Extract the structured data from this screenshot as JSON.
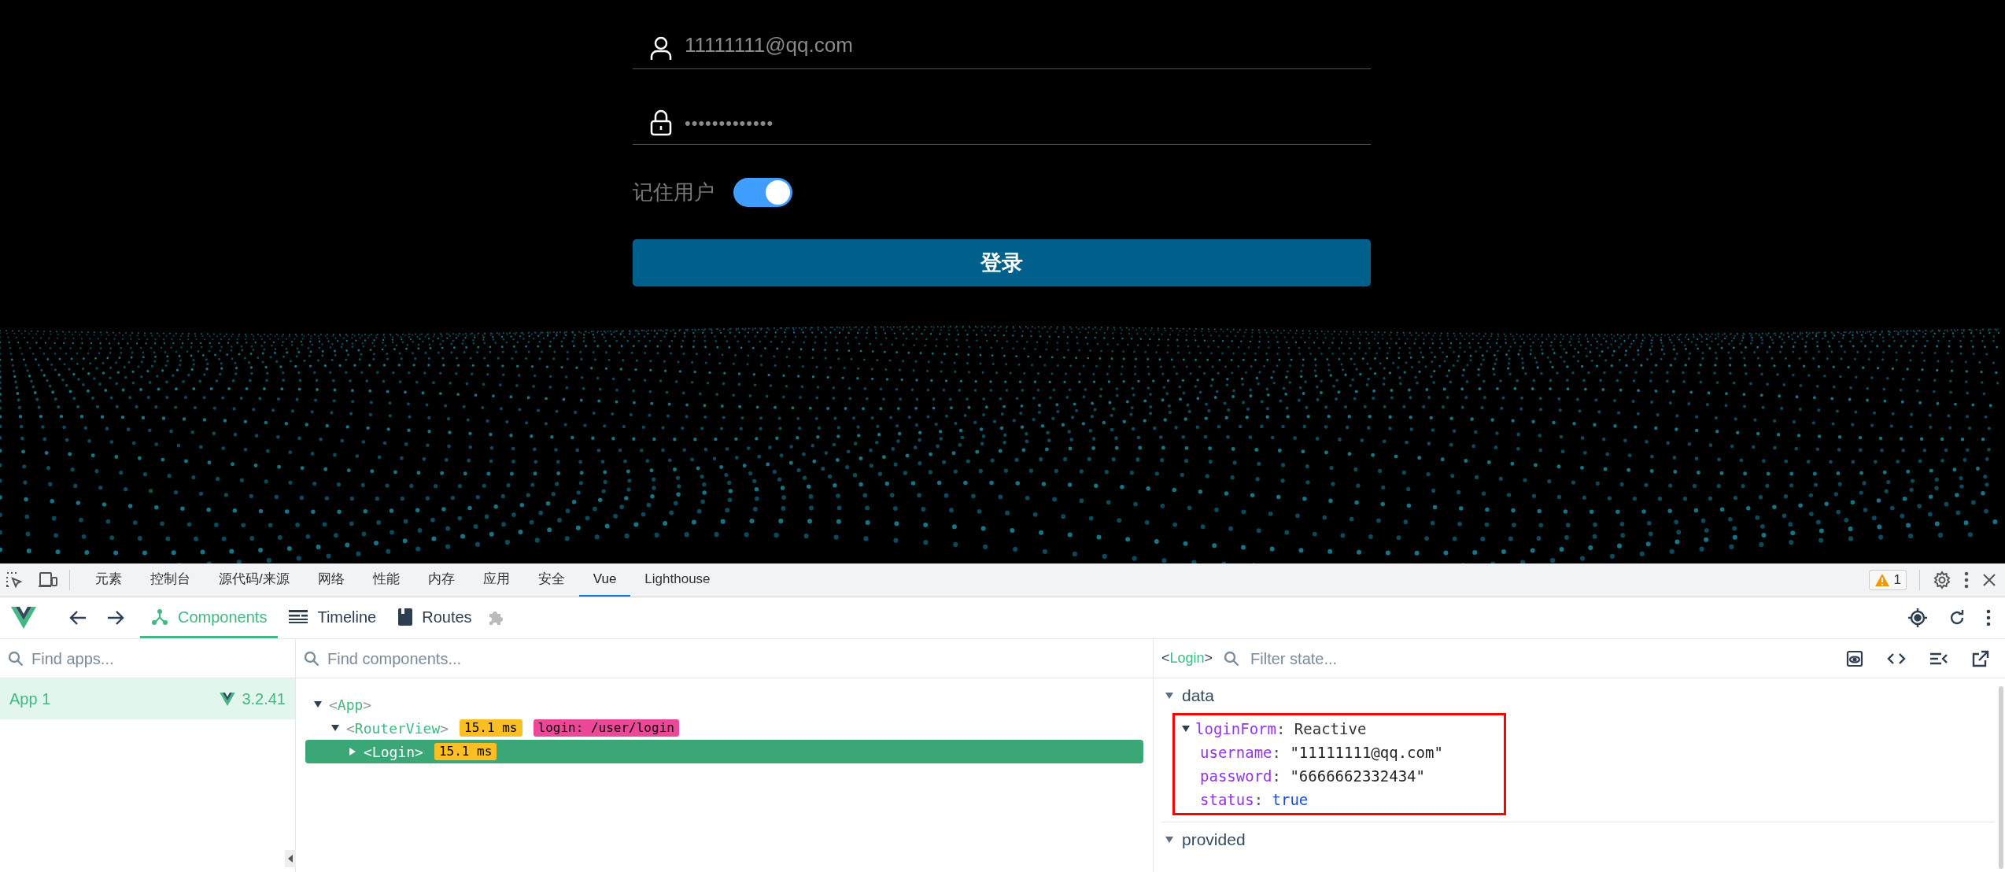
{
  "login": {
    "username": {
      "value": "11111111@qq.com"
    },
    "password": {
      "value": "•••••••••••••"
    },
    "remember": {
      "label": "记住用户",
      "on": true
    },
    "submit": {
      "label": "登录"
    }
  },
  "devtools": {
    "tabs": [
      {
        "label": "元素",
        "selected": false
      },
      {
        "label": "控制台",
        "selected": false
      },
      {
        "label": "源代码/来源",
        "selected": false
      },
      {
        "label": "网络",
        "selected": false
      },
      {
        "label": "性能",
        "selected": false
      },
      {
        "label": "内存",
        "selected": false
      },
      {
        "label": "应用",
        "selected": false
      },
      {
        "label": "安全",
        "selected": false
      },
      {
        "label": "Vue",
        "selected": true
      },
      {
        "label": "Lighthouse",
        "selected": false
      }
    ],
    "warnings": "1",
    "vue_tabs": [
      {
        "label": "Components",
        "selected": true,
        "kind": "components"
      },
      {
        "label": "Timeline",
        "selected": false,
        "kind": "timeline"
      },
      {
        "label": "Routes",
        "selected": false,
        "kind": "routes"
      }
    ],
    "apps": {
      "search": {
        "placeholder": "Find apps..."
      },
      "items": [
        {
          "name": "App 1",
          "version": "3.2.41",
          "selected": true
        }
      ]
    },
    "components": {
      "search": {
        "placeholder": "Find components..."
      },
      "tree": [
        {
          "name": "<App>",
          "expanded": true,
          "selected": false,
          "children": [
            {
              "name": "<RouterView>",
              "expanded": true,
              "selected": false,
              "badges": [
                {
                  "text": "15.1 ms",
                  "kind": "time"
                },
                {
                  "text": "login: /user/login",
                  "kind": "route"
                }
              ],
              "children": [
                {
                  "name": "<Login>",
                  "expanded": false,
                  "selected": true,
                  "badges": [
                    {
                      "text": "15.1 ms",
                      "kind": "time"
                    }
                  ]
                }
              ]
            }
          ]
        }
      ]
    },
    "inspector": {
      "component": "<Login>",
      "search": {
        "placeholder": "Filter state..."
      },
      "separator": ":",
      "sections": [
        {
          "label": "data",
          "expanded": true,
          "properties": [
            {
              "key": "loginForm",
              "value": "Reactive",
              "kind": "object",
              "expanded": true,
              "highlighted": true,
              "children": [
                {
                  "key": "username",
                  "value": "\"11111111@qq.com\"",
                  "kind": "string"
                },
                {
                  "key": "password",
                  "value": "\"6666662332434\"",
                  "kind": "string"
                },
                {
                  "key": "status",
                  "value": "true",
                  "kind": "boolean"
                }
              ]
            }
          ]
        },
        {
          "label": "provided",
          "expanded": true
        }
      ]
    }
  }
}
